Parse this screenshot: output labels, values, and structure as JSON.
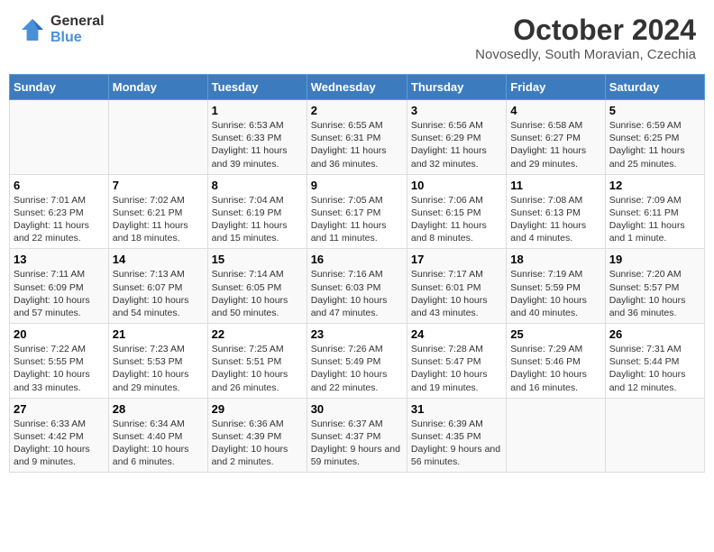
{
  "header": {
    "logo_general": "General",
    "logo_blue": "Blue",
    "month_title": "October 2024",
    "subtitle": "Novosedly, South Moravian, Czechia"
  },
  "days_of_week": [
    "Sunday",
    "Monday",
    "Tuesday",
    "Wednesday",
    "Thursday",
    "Friday",
    "Saturday"
  ],
  "weeks": [
    [
      null,
      null,
      {
        "day": 1,
        "sunrise": "6:53 AM",
        "sunset": "6:33 PM",
        "daylight": "11 hours and 39 minutes."
      },
      {
        "day": 2,
        "sunrise": "6:55 AM",
        "sunset": "6:31 PM",
        "daylight": "11 hours and 36 minutes."
      },
      {
        "day": 3,
        "sunrise": "6:56 AM",
        "sunset": "6:29 PM",
        "daylight": "11 hours and 32 minutes."
      },
      {
        "day": 4,
        "sunrise": "6:58 AM",
        "sunset": "6:27 PM",
        "daylight": "11 hours and 29 minutes."
      },
      {
        "day": 5,
        "sunrise": "6:59 AM",
        "sunset": "6:25 PM",
        "daylight": "11 hours and 25 minutes."
      }
    ],
    [
      {
        "day": 6,
        "sunrise": "7:01 AM",
        "sunset": "6:23 PM",
        "daylight": "11 hours and 22 minutes."
      },
      {
        "day": 7,
        "sunrise": "7:02 AM",
        "sunset": "6:21 PM",
        "daylight": "11 hours and 18 minutes."
      },
      {
        "day": 8,
        "sunrise": "7:04 AM",
        "sunset": "6:19 PM",
        "daylight": "11 hours and 15 minutes."
      },
      {
        "day": 9,
        "sunrise": "7:05 AM",
        "sunset": "6:17 PM",
        "daylight": "11 hours and 11 minutes."
      },
      {
        "day": 10,
        "sunrise": "7:06 AM",
        "sunset": "6:15 PM",
        "daylight": "11 hours and 8 minutes."
      },
      {
        "day": 11,
        "sunrise": "7:08 AM",
        "sunset": "6:13 PM",
        "daylight": "11 hours and 4 minutes."
      },
      {
        "day": 12,
        "sunrise": "7:09 AM",
        "sunset": "6:11 PM",
        "daylight": "11 hours and 1 minute."
      }
    ],
    [
      {
        "day": 13,
        "sunrise": "7:11 AM",
        "sunset": "6:09 PM",
        "daylight": "10 hours and 57 minutes."
      },
      {
        "day": 14,
        "sunrise": "7:13 AM",
        "sunset": "6:07 PM",
        "daylight": "10 hours and 54 minutes."
      },
      {
        "day": 15,
        "sunrise": "7:14 AM",
        "sunset": "6:05 PM",
        "daylight": "10 hours and 50 minutes."
      },
      {
        "day": 16,
        "sunrise": "7:16 AM",
        "sunset": "6:03 PM",
        "daylight": "10 hours and 47 minutes."
      },
      {
        "day": 17,
        "sunrise": "7:17 AM",
        "sunset": "6:01 PM",
        "daylight": "10 hours and 43 minutes."
      },
      {
        "day": 18,
        "sunrise": "7:19 AM",
        "sunset": "5:59 PM",
        "daylight": "10 hours and 40 minutes."
      },
      {
        "day": 19,
        "sunrise": "7:20 AM",
        "sunset": "5:57 PM",
        "daylight": "10 hours and 36 minutes."
      }
    ],
    [
      {
        "day": 20,
        "sunrise": "7:22 AM",
        "sunset": "5:55 PM",
        "daylight": "10 hours and 33 minutes."
      },
      {
        "day": 21,
        "sunrise": "7:23 AM",
        "sunset": "5:53 PM",
        "daylight": "10 hours and 29 minutes."
      },
      {
        "day": 22,
        "sunrise": "7:25 AM",
        "sunset": "5:51 PM",
        "daylight": "10 hours and 26 minutes."
      },
      {
        "day": 23,
        "sunrise": "7:26 AM",
        "sunset": "5:49 PM",
        "daylight": "10 hours and 22 minutes."
      },
      {
        "day": 24,
        "sunrise": "7:28 AM",
        "sunset": "5:47 PM",
        "daylight": "10 hours and 19 minutes."
      },
      {
        "day": 25,
        "sunrise": "7:29 AM",
        "sunset": "5:46 PM",
        "daylight": "10 hours and 16 minutes."
      },
      {
        "day": 26,
        "sunrise": "7:31 AM",
        "sunset": "5:44 PM",
        "daylight": "10 hours and 12 minutes."
      }
    ],
    [
      {
        "day": 27,
        "sunrise": "6:33 AM",
        "sunset": "4:42 PM",
        "daylight": "10 hours and 9 minutes."
      },
      {
        "day": 28,
        "sunrise": "6:34 AM",
        "sunset": "4:40 PM",
        "daylight": "10 hours and 6 minutes."
      },
      {
        "day": 29,
        "sunrise": "6:36 AM",
        "sunset": "4:39 PM",
        "daylight": "10 hours and 2 minutes."
      },
      {
        "day": 30,
        "sunrise": "6:37 AM",
        "sunset": "4:37 PM",
        "daylight": "9 hours and 59 minutes."
      },
      {
        "day": 31,
        "sunrise": "6:39 AM",
        "sunset": "4:35 PM",
        "daylight": "9 hours and 56 minutes."
      },
      null,
      null
    ]
  ]
}
